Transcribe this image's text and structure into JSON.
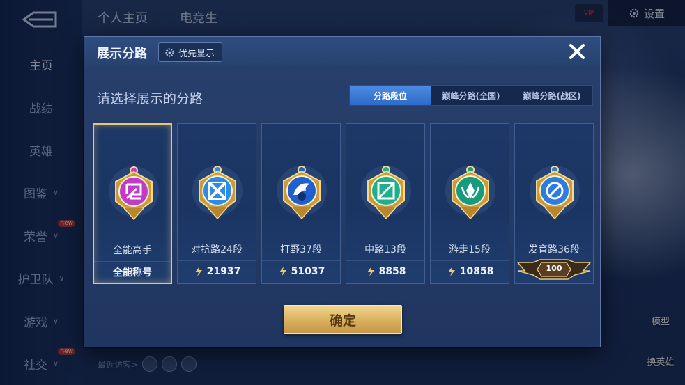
{
  "nav": {
    "items": [
      {
        "label": "主页",
        "active": true,
        "chevron": false,
        "new": false
      },
      {
        "label": "战绩",
        "active": false,
        "chevron": false,
        "new": false
      },
      {
        "label": "英雄",
        "active": false,
        "chevron": false,
        "new": false
      },
      {
        "label": "图鉴",
        "active": false,
        "chevron": true,
        "new": false
      },
      {
        "label": "荣誉",
        "active": false,
        "chevron": true,
        "new": true
      },
      {
        "label": "护卫队",
        "active": false,
        "chevron": true,
        "new": false
      },
      {
        "label": "游戏",
        "active": false,
        "chevron": true,
        "new": false
      },
      {
        "label": "社交",
        "active": false,
        "chevron": true,
        "new": true
      }
    ]
  },
  "top_tabs": [
    "个人主页",
    "电竞生"
  ],
  "header_right": {
    "settings_label": "设置",
    "vip_label": "VIP"
  },
  "recent_visitors_label": "最近访客>",
  "right_widgets": [
    {
      "label": "模型"
    },
    {
      "label": "换英雄"
    }
  ],
  "dialog": {
    "title": "展示分路",
    "priority_label": "优先显示",
    "prompt": "请选择展示的分路",
    "filter_tabs": [
      "分路段位",
      "巅峰分路(全国)",
      "巅峰分路(战区)"
    ],
    "active_filter": 0,
    "cards": [
      {
        "name": "全能高手",
        "stat": "全能称号",
        "kind": "title",
        "emblem": "all-round-emblem-icon",
        "color": "#c03bc8",
        "selected": true
      },
      {
        "name": "对抗路24段",
        "stat": "21937",
        "kind": "score",
        "emblem": "clash-lane-emblem-icon",
        "color": "#2b8be6",
        "selected": false
      },
      {
        "name": "打野37段",
        "stat": "51037",
        "kind": "score",
        "emblem": "jungle-emblem-icon",
        "color": "#1f5fd0",
        "selected": false
      },
      {
        "name": "中路13段",
        "stat": "8858",
        "kind": "score",
        "emblem": "mid-lane-emblem-icon",
        "color": "#1fae8e",
        "selected": false
      },
      {
        "name": "游走15段",
        "stat": "10858",
        "kind": "score",
        "emblem": "roam-emblem-icon",
        "color": "#179a7e",
        "selected": false
      },
      {
        "name": "发育路36段",
        "stat": "100",
        "kind": "rank",
        "emblem": "farm-lane-emblem-icon",
        "color": "#2d7de0",
        "selected": false
      }
    ],
    "confirm_label": "确定"
  },
  "colors": {
    "gold": "#e8c67a",
    "accent": "#3a7bd8",
    "panel": "#233a64"
  }
}
